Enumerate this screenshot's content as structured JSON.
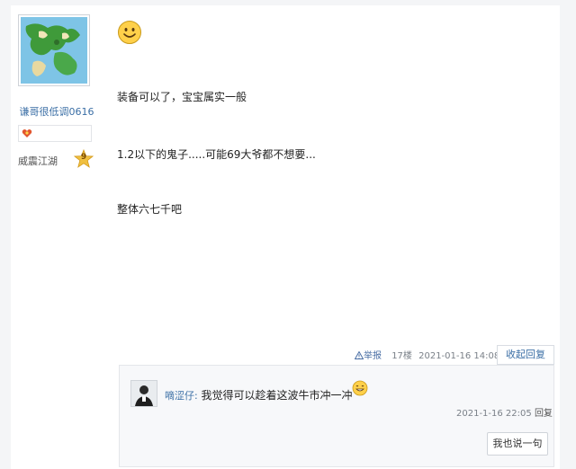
{
  "author": {
    "username": "谦哥很低调0616",
    "rank_title": "威震江湖",
    "rank_level": "9"
  },
  "post": {
    "emoji": "smiley-face",
    "lines": [
      "装备可以了，宝宝属实一般",
      "1.2以下的鬼子.....可能69大爷都不想要...",
      "整体六七千吧"
    ],
    "report_label": "举报",
    "floor": "17楼",
    "timestamp": "2021-01-16 14:08",
    "collapse_label": "收起回复"
  },
  "comment": {
    "user": "嘀涩仔:",
    "text": "我觉得可以趁着这波牛市冲一冲",
    "timestamp": "2021-1-16 22:05",
    "reply_label": "回复",
    "say_button": "我也说一句"
  },
  "colors": {
    "link": "#3a6ea5",
    "background": "#f4f5f7"
  }
}
